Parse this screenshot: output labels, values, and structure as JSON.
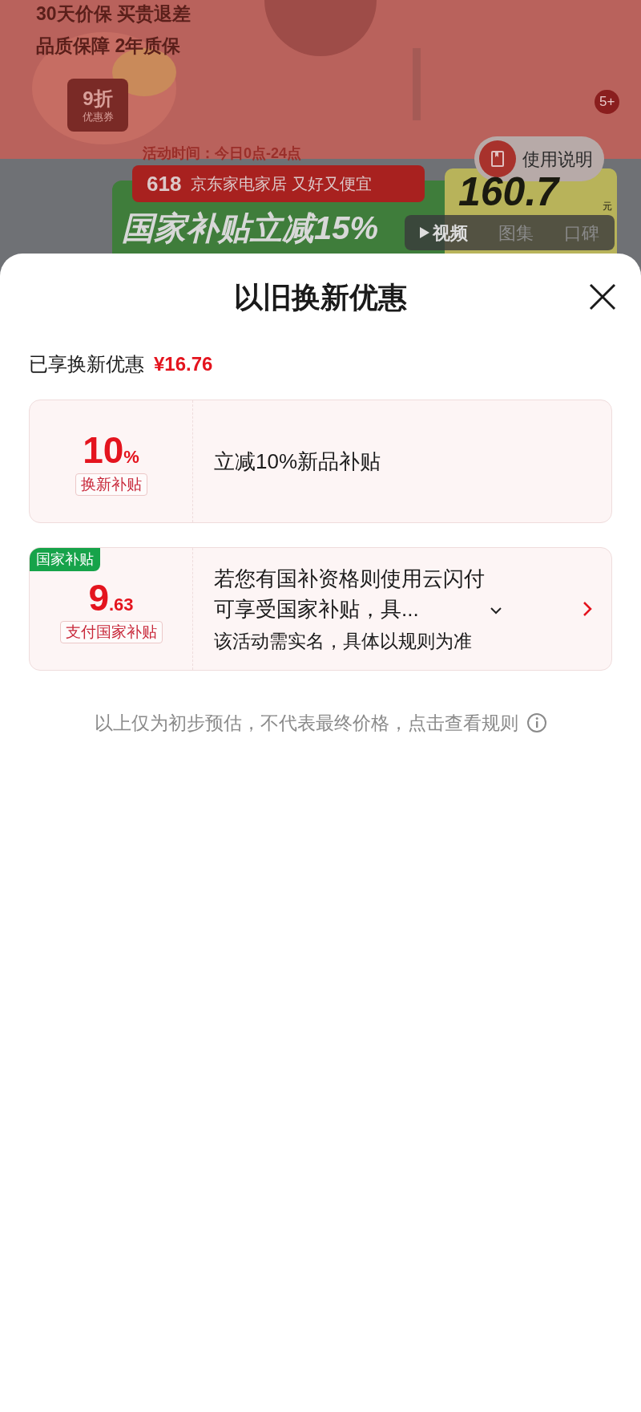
{
  "background": {
    "guarantee_1": "30天价保 买贵退差",
    "guarantee_2": "品质保障 2年质保",
    "coupon": {
      "discount": "9折",
      "label": "优惠券"
    },
    "badge": "5+",
    "activity_time": "活动时间：今日0点-24点",
    "guide_button": "使用说明",
    "banner": {
      "number": "618",
      "slogan": "京东家电家居 又好又便宜",
      "headline": "国家补贴立减15%"
    },
    "price": {
      "value": "160.7",
      "unit": "元"
    },
    "media_tabs": [
      {
        "label": "视频",
        "selected": true
      },
      {
        "label": "图集",
        "selected": false
      },
      {
        "label": "口碑",
        "selected": false
      }
    ]
  },
  "sheet": {
    "title": "以旧换新优惠",
    "summary": {
      "label": "已享换新优惠",
      "amount": "¥16.76"
    },
    "offers": [
      {
        "amount_main": "10",
        "amount_suffix": "%",
        "tag": "换新补贴",
        "lines": [
          {
            "kind": "main",
            "text": "立减10%新品补贴"
          }
        ],
        "chevron": false
      },
      {
        "corner_tag": "国家补贴",
        "amount_main": "9",
        "amount_suffix": ".63",
        "tag": "支付国家补贴",
        "lines": [
          {
            "kind": "expandable",
            "text": "若您有国补资格则使用云闪付可享受国家补贴，具..."
          },
          {
            "kind": "note",
            "text": "该活动需实名，具体以规则为准"
          }
        ],
        "chevron": true
      }
    ],
    "disclaimer": "以上仅为初步预估，不代表最终价格，点击查看规则"
  }
}
